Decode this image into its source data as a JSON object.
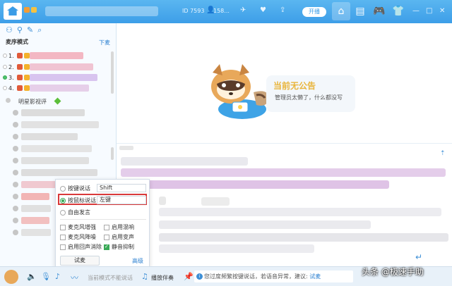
{
  "topbar": {
    "id_label": "ID 7593",
    "count_label": "158...",
    "open_button": "开播"
  },
  "left": {
    "mode_label": "麦序模式",
    "mode_link": "下麦",
    "queue_numbers": [
      "1.",
      "2.",
      "3.",
      "4."
    ],
    "group_name": "明星影视评"
  },
  "announcement": {
    "title": "当前无公告",
    "subtitle": "管理员太懒了，什么都没写"
  },
  "popup": {
    "opt_key": "按键说话",
    "opt_key_value": "Shift",
    "opt_mouse": "按鼠标说话",
    "opt_mouse_value": "左键",
    "opt_free": "自由发言",
    "chk_mic_boost": "麦克风增强",
    "chk_reverb": "启用混响",
    "chk_mic_denoise": "麦克风降噪",
    "chk_voice_change": "启用变声",
    "chk_echo": "启用回声消除",
    "chk_mute_suppress": "静音抑制",
    "test_button": "试麦",
    "advanced_link": "高级"
  },
  "bottombar": {
    "mode_hint": "当前模式不能说话",
    "accompany": "播放伴奏",
    "notice": "您过度频繁按键说话，若语音异常，建议:",
    "notice_try": "试麦",
    "watermark": "头条 @极速手助"
  },
  "colors": {
    "primary": "#3d9ee8",
    "highlight_border": "#d9393a",
    "check_green": "#3aa957",
    "title_yellow": "#e9b53b"
  }
}
